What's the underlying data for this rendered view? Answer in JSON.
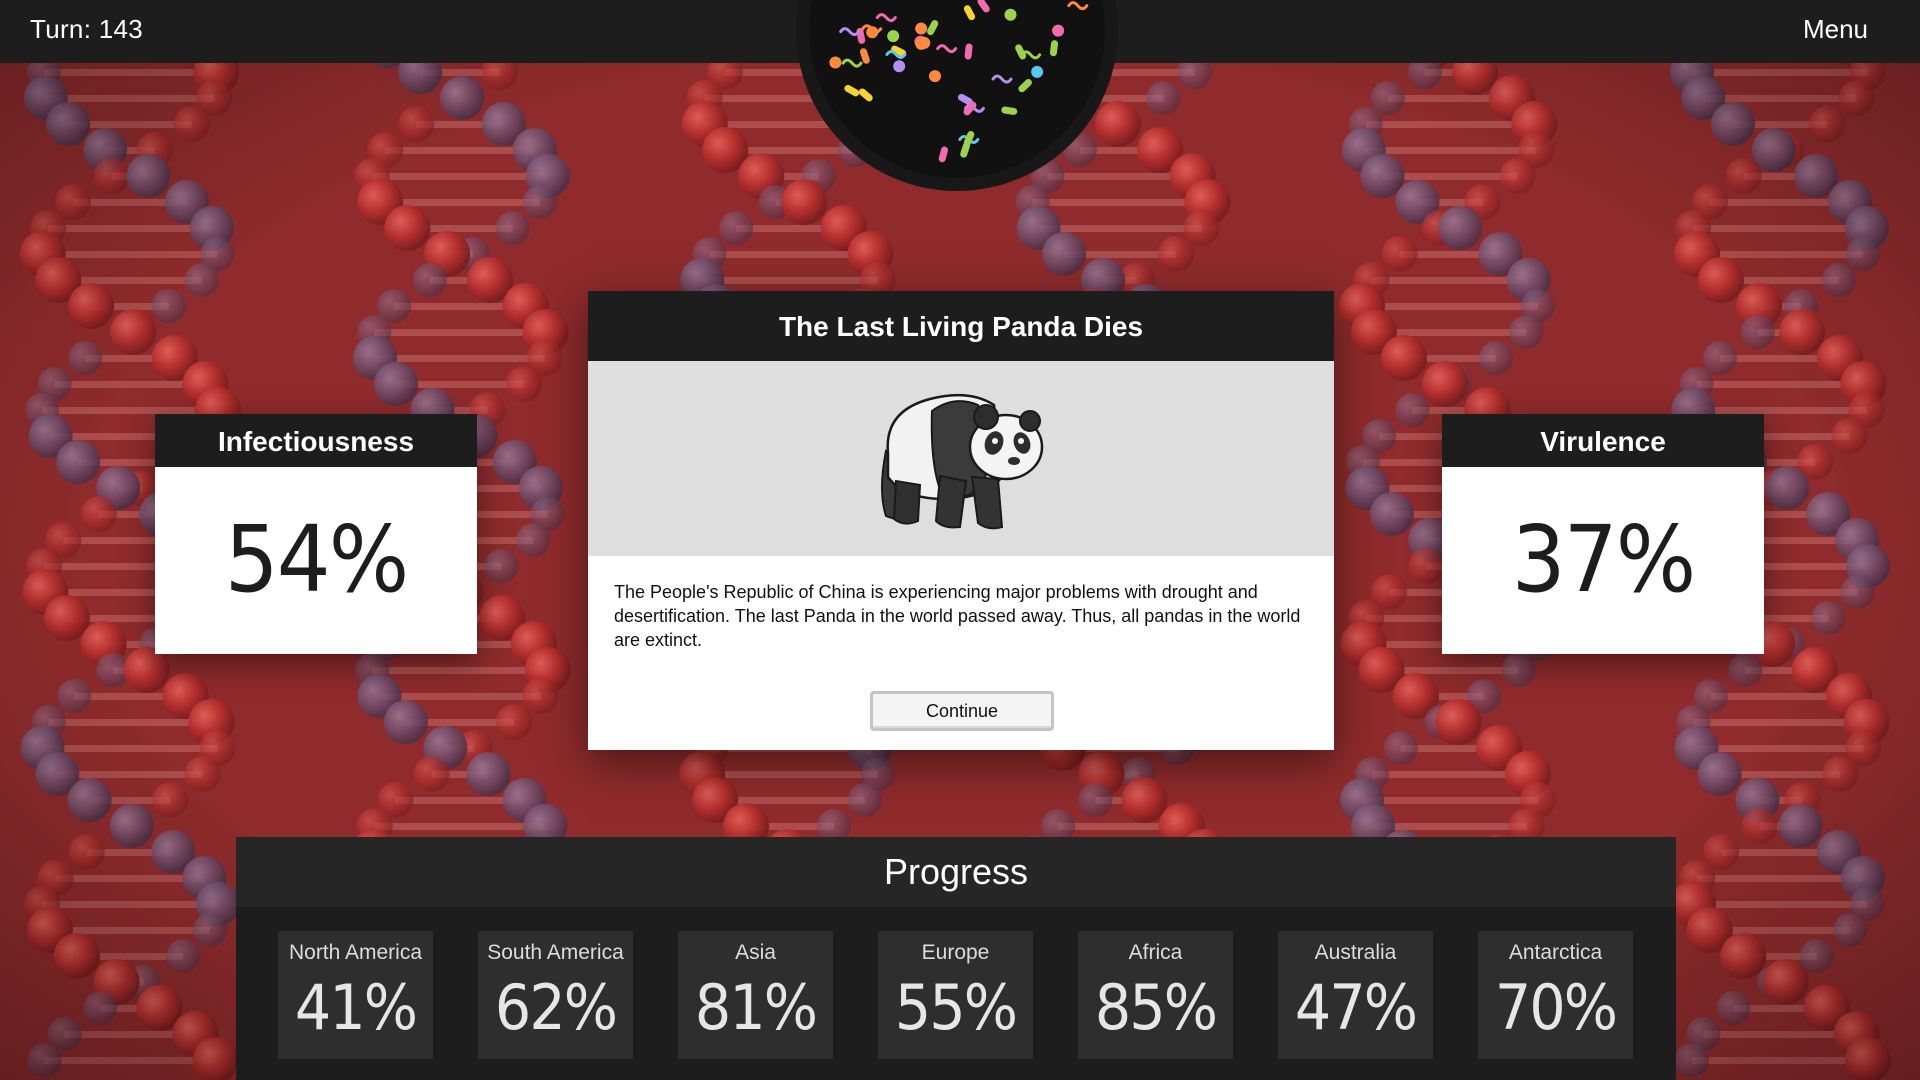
{
  "header": {
    "turn_label": "Turn: 143",
    "menu_label": "Menu"
  },
  "stats": {
    "infectiousness": {
      "label": "Infectiousness",
      "value": "54%"
    },
    "virulence": {
      "label": "Virulence",
      "value": "37%"
    }
  },
  "event_modal": {
    "title": "The Last Living Panda Dies",
    "image_icon": "panda-icon",
    "message": "The People's Republic of China is experiencing major problems with drought and desertification. The last Panda in the world passed away. Thus, all pandas in the world are extinct.",
    "continue_label": "Continue"
  },
  "progress": {
    "title": "Progress",
    "regions": [
      {
        "name": "North America",
        "value": "41%"
      },
      {
        "name": "South America",
        "value": "62%"
      },
      {
        "name": "Asia",
        "value": "81%"
      },
      {
        "name": "Europe",
        "value": "55%"
      },
      {
        "name": "Africa",
        "value": "85%"
      },
      {
        "name": "Australia",
        "value": "47%"
      },
      {
        "name": "Antarctica",
        "value": "70%"
      }
    ]
  },
  "colors": {
    "background": "#8f2b2c",
    "panel_dark": "#1d1d1d",
    "region_tile": "#2e2e2e",
    "modal_image_bg": "#dedede"
  }
}
